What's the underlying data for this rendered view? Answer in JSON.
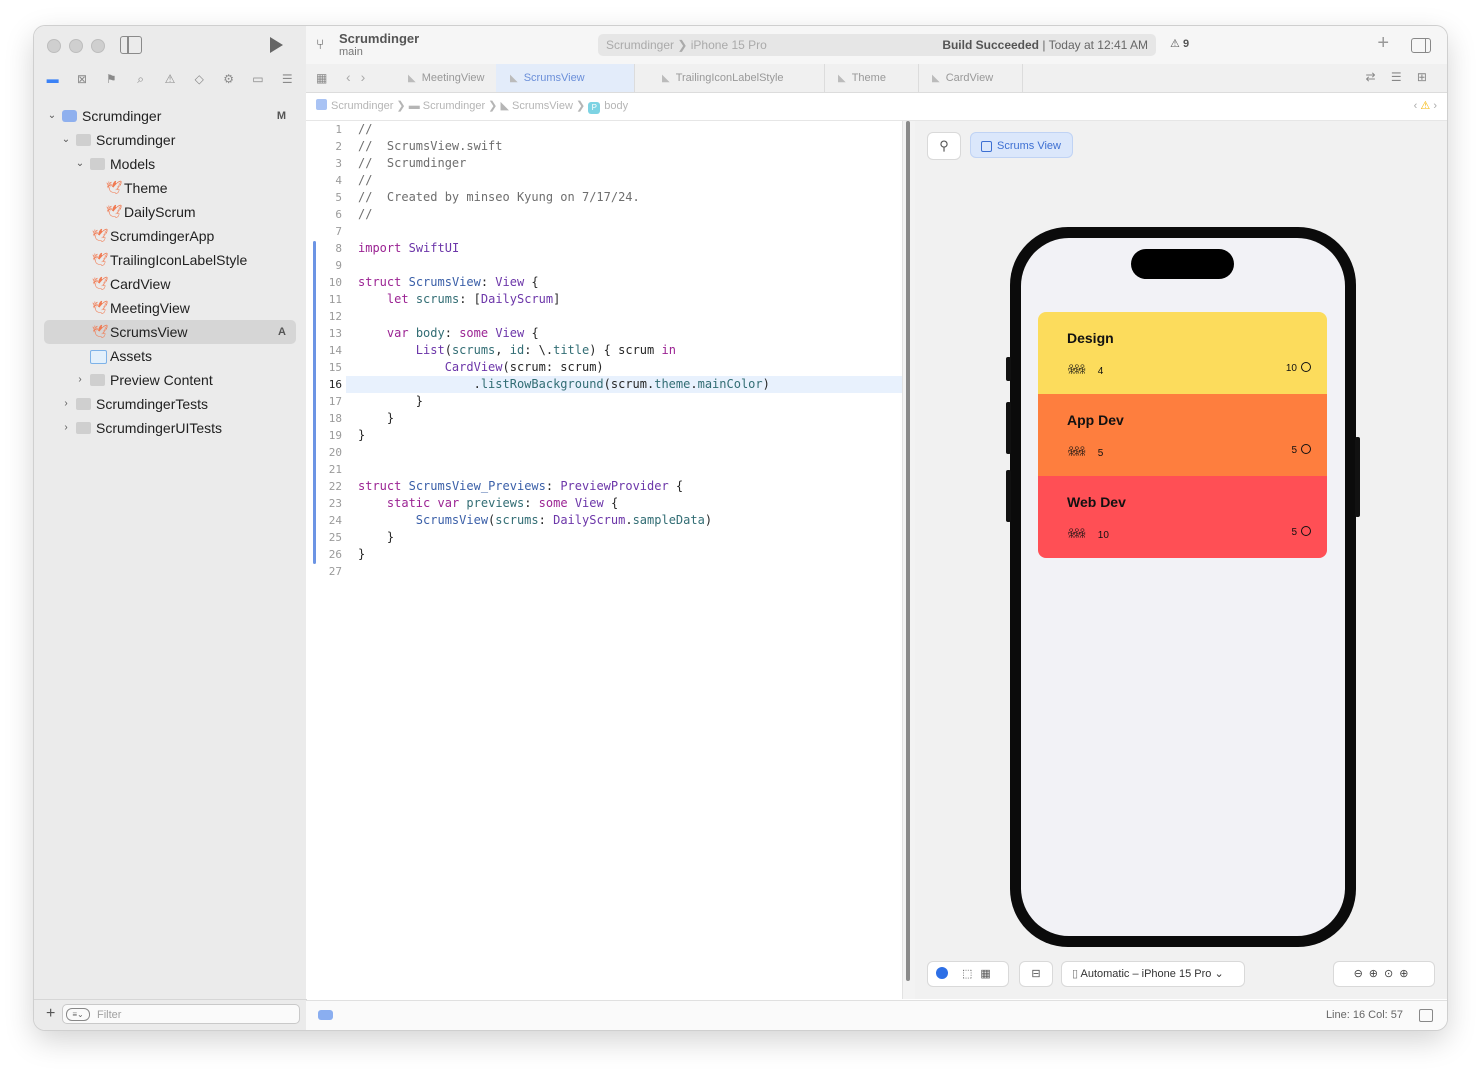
{
  "toolbar": {
    "project": "Scrumdinger",
    "branch": "main",
    "scheme": "Scrumdinger ❯ iPhone 15 Pro",
    "status_bold": "Build Succeeded",
    "status_time": "| Today at 12:41 AM",
    "warnings": "9"
  },
  "navigator": {
    "items": [
      {
        "label": "Scrumdinger",
        "badge": "M"
      },
      {
        "label": "Scrumdinger"
      },
      {
        "label": "Models"
      },
      {
        "label": "Theme"
      },
      {
        "label": "DailyScrum"
      },
      {
        "label": "ScrumdingerApp"
      },
      {
        "label": "TrailingIconLabelStyle"
      },
      {
        "label": "CardView"
      },
      {
        "label": "MeetingView"
      },
      {
        "label": "ScrumsView",
        "badge": "A"
      },
      {
        "label": "Assets"
      },
      {
        "label": "Preview Content"
      },
      {
        "label": "ScrumdingerTests"
      },
      {
        "label": "ScrumdingerUITests"
      }
    ],
    "filter_placeholder": "Filter"
  },
  "tabs": [
    "MeetingView",
    "ScrumsView",
    "TrailingIconLabelStyle",
    "Theme",
    "CardView"
  ],
  "jumpbar": [
    "Scrumdinger",
    "Scrumdinger",
    "ScrumsView",
    "body"
  ],
  "editor": {
    "current_line": 16,
    "lines": [
      "//",
      "//  ScrumsView.swift",
      "//  Scrumdinger",
      "//",
      "//  Created by minseo Kyung on 7/17/24.",
      "//",
      "",
      "import SwiftUI",
      "",
      "struct ScrumsView: View {",
      "    let scrums: [DailyScrum]",
      "",
      "    var body: some View {",
      "        List(scrums, id: \\.title) { scrum in",
      "            CardView(scrum: scrum)",
      "                .listRowBackground(scrum.theme.mainColor)",
      "        }",
      "    }",
      "}",
      "",
      "",
      "struct ScrumsView_Previews: PreviewProvider {",
      "    static var previews: some View {",
      "        ScrumsView(scrums: DailyScrum.sampleData)",
      "    }",
      "}",
      ""
    ]
  },
  "preview": {
    "button_label": "Scrums View",
    "device_label": "Automatic – iPhone 15 Pro",
    "cards": [
      {
        "title": "Design",
        "attendees": "4",
        "length": "10",
        "color": "#fcdc5c"
      },
      {
        "title": "App Dev",
        "attendees": "5",
        "length": "5",
        "color": "#fe7e3e"
      },
      {
        "title": "Web Dev",
        "attendees": "10",
        "length": "5",
        "color": "#ff4f55"
      }
    ]
  },
  "statusbar": {
    "position": "Line: 16  Col: 57"
  }
}
